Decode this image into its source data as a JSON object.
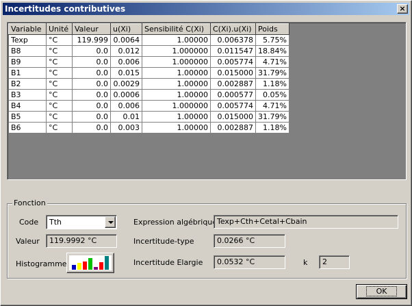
{
  "window": {
    "title": "Incertitudes contributives",
    "close_label": "×"
  },
  "grid": {
    "columns": [
      "Variable",
      "Unité",
      "Valeur",
      "u(Xi)",
      "Sensibilité C(Xi)",
      "C(Xi).u(Xi)",
      "Poids"
    ],
    "rows": [
      [
        "Texp",
        "°C",
        "119.999",
        "0.0064",
        "1.00000",
        "0.006378",
        "5.75%"
      ],
      [
        "B8",
        "°C",
        "0.0",
        "0.012",
        "1.000000",
        "0.011547",
        "18.84%"
      ],
      [
        "B9",
        "°C",
        "0.0",
        "0.006",
        "1.000000",
        "0.005774",
        "4.71%"
      ],
      [
        "B1",
        "°C",
        "0.0",
        "0.015",
        "1.00000",
        "0.015000",
        "31.79%"
      ],
      [
        "B2",
        "°C",
        "0.0",
        "0.0029",
        "1.00000",
        "0.002887",
        "1.18%"
      ],
      [
        "B3",
        "°C",
        "0.0",
        "0.0006",
        "1.00000",
        "0.000577",
        "0.05%"
      ],
      [
        "B4",
        "°C",
        "0.0",
        "0.006",
        "1.000000",
        "0.005774",
        "4.71%"
      ],
      [
        "B5",
        "°C",
        "0.0",
        "0.01",
        "1.00000",
        "0.015000",
        "31.79%"
      ],
      [
        "B6",
        "°C",
        "0.0",
        "0.003",
        "1.00000",
        "0.002887",
        "1.18%"
      ]
    ]
  },
  "fonction": {
    "legend": "Fonction",
    "code_label": "Code",
    "code_value": "Tth",
    "valeur_label": "Valeur",
    "valeur_value": "119.9992 °C",
    "histogramme_label": "Histogramme",
    "histogram_bars": [
      {
        "color": "#0000c0",
        "level": 0.35
      },
      {
        "color": "#ffff00",
        "level": 0.5
      },
      {
        "color": "#ff0000",
        "level": 0.6
      },
      {
        "color": "#00c000",
        "level": 0.85
      },
      {
        "color": "#800080",
        "level": 0.2
      },
      {
        "color": "#ff0000",
        "level": 0.55
      },
      {
        "color": "#008080",
        "level": 1.0
      }
    ],
    "expression_label": "Expression algébrique",
    "expression_value": "Texp+Cth+Cetal+Cbain",
    "incertitude_type_label": "Incertitude-type",
    "incertitude_type_value": "0.0266 °C",
    "incertitude_elargie_label": "Incertitude Elargie",
    "incertitude_elargie_value": "0.0532 °C",
    "k_label": "k",
    "k_value": "2"
  },
  "ok_label": "OK"
}
